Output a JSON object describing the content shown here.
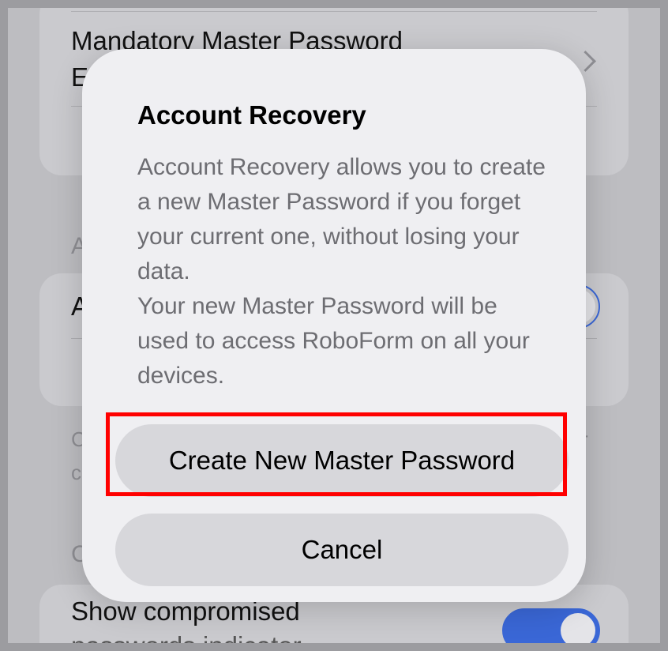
{
  "background": {
    "row_mandatory_line1": "Mandatory Master Password",
    "row_mandatory_line2": "E",
    "section_a_header": "A",
    "row_a_label": "A",
    "footnote_left": "C",
    "footnote_left2": "c",
    "footnote_right": "r",
    "section_c_header": "C",
    "row_compromised_line1": "Show compromised",
    "row_compromised_line2": "passwords indicator"
  },
  "dialog": {
    "title": "Account Recovery",
    "body_p1": "Account Recovery allows you to create a new Master Password if you forget your current one, without losing your data.",
    "body_p2": "Your new Master Password will be used to access RoboForm on all your devices.",
    "primary_button": "Create New Master Password",
    "cancel_button": "Cancel"
  },
  "colors": {
    "highlight": "#ff0000",
    "toggle_on": "#3a67d6"
  }
}
